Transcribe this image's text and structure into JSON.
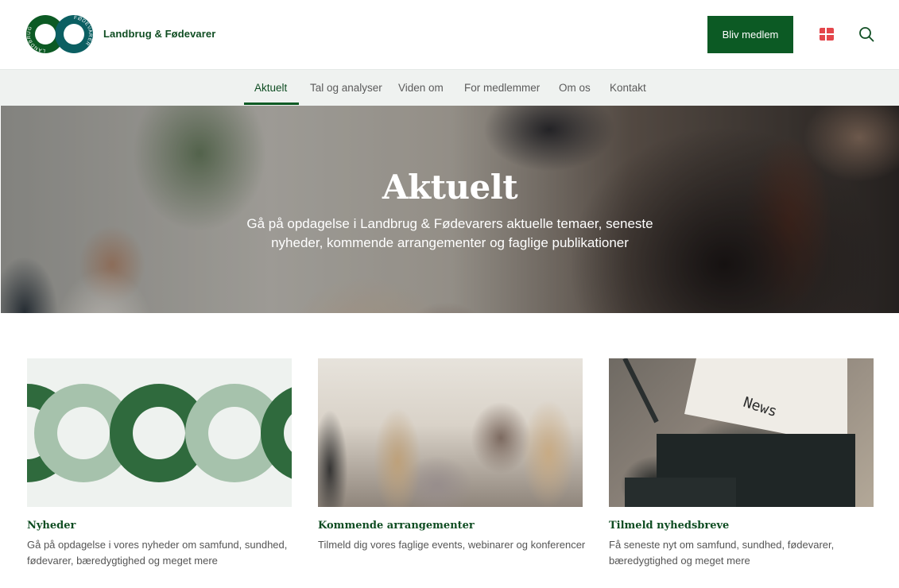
{
  "header": {
    "brand_name": "Landbrug & Fødevarer",
    "logo_ring_text_left": "LANDBRUG",
    "logo_ring_text_right": "FØDEVARER",
    "join_button": "Bliv medlem",
    "language_icon": "danish-flag-icon",
    "search_icon": "search-icon",
    "colors": {
      "brand_green": "#0c5a24",
      "brand_teal": "#0b5f62",
      "flag_red": "#e4464b"
    }
  },
  "nav": {
    "items": [
      {
        "label": "Aktuelt",
        "active": true
      },
      {
        "label": "Tal og analyser",
        "active": false
      },
      {
        "label": "Viden om",
        "active": false
      },
      {
        "label": "For medlemmer",
        "active": false
      },
      {
        "label": "Om os",
        "active": false
      },
      {
        "label": "Kontakt",
        "active": false
      }
    ]
  },
  "hero": {
    "title": "Aktuelt",
    "subtitle": "Gå på opdagelse i Landbrug & Fødevarers aktuelle temaer, seneste nyheder, kommende arrangementer og faglige publikationer"
  },
  "cards": [
    {
      "title": "Nyheder",
      "text": "Gå på opdagelse i vores nyheder om samfund, sundhed, fødevarer, bæredygtighed og meget mere"
    },
    {
      "title": "Kommende arrangementer",
      "text": "Tilmeld dig vores faglige events, webinarer og konferencer"
    },
    {
      "title": "Tilmeld nyhedsbreve",
      "text": "Få seneste nyt om samfund, sundhed, fødevarer, bæredygtighed og meget mere",
      "image_text": "News"
    }
  ]
}
